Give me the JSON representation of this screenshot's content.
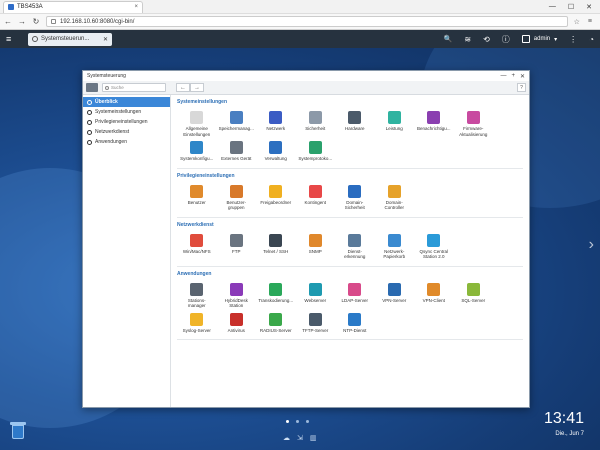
{
  "browser": {
    "tab_title": "TBS453A",
    "url": "192.168.10.60:8080/cgi-bin/",
    "close_glyph": "×",
    "win_min": "—",
    "win_max": "☐",
    "win_close": "✕",
    "back_glyph": "←",
    "forward_glyph": "→",
    "reload_glyph": "↻",
    "star_glyph": "☆",
    "menu_glyph": "≡"
  },
  "qts": {
    "app_tab": "Systemsteuerun...",
    "tab_close": "✕",
    "user": "admin",
    "menu_glyph": "≡",
    "search_glyph": "🔍",
    "tasks_glyph": "≋",
    "sync_glyph": "⟲",
    "info_glyph": "ⓘ",
    "more_glyph": "⋮",
    "dashboard_glyph": "◔"
  },
  "window": {
    "title": "Systemsteuerung",
    "ctrl_min": "—",
    "ctrl_max": "+",
    "ctrl_close": "✕",
    "search_placeholder": "Suche",
    "back_glyph": "←",
    "forward_glyph": "→",
    "help_glyph": "?"
  },
  "sidebar": {
    "items": [
      {
        "label": "Überblick",
        "active": true
      },
      {
        "label": "Systemeinstellungen"
      },
      {
        "label": "Privilegieneinstellungen"
      },
      {
        "label": "Netzwerkdienst"
      },
      {
        "label": "Anwendungen"
      }
    ]
  },
  "sections": [
    {
      "title": "Systemeinstellungen",
      "items": [
        {
          "l1": "Allgemeine",
          "l2": "Einstellungen",
          "icon": "general-settings-icon",
          "color": "#d8d8d8"
        },
        {
          "l1": "Speichermanag...",
          "l2": "",
          "icon": "storage-manager-icon",
          "color": "#4a7fc1"
        },
        {
          "l1": "Netzwerk",
          "l2": "",
          "icon": "network-icon",
          "color": "#3b5cc4"
        },
        {
          "l1": "Sicherheit",
          "l2": "",
          "icon": "security-lock-icon",
          "color": "#8c99a8"
        },
        {
          "l1": "Hardware",
          "l2": "",
          "icon": "hardware-icon",
          "color": "#4b5a6a"
        },
        {
          "l1": "Leistung",
          "l2": "",
          "icon": "power-bulb-icon",
          "color": "#2fb3a0"
        },
        {
          "l1": "Benachrichtigu...",
          "l2": "",
          "icon": "notification-icon",
          "color": "#8a3fb0"
        },
        {
          "l1": "Firmware-",
          "l2": "Aktualisierung",
          "icon": "firmware-update-icon",
          "color": "#c84aa0"
        },
        {
          "l1": "Systemkonfigu...",
          "l2": "",
          "icon": "system-config-icon",
          "color": "#2e86c8"
        },
        {
          "l1": "Externes Gerät",
          "l2": "",
          "icon": "external-device-icon",
          "color": "#6a7480"
        },
        {
          "l1": "Verwaltung",
          "l2": "",
          "icon": "management-monitor-icon",
          "color": "#2c6fc0"
        },
        {
          "l1": "Systemprotoko...",
          "l2": "",
          "icon": "system-logs-icon",
          "color": "#2aa16c"
        }
      ]
    },
    {
      "title": "Privilegieneinstellungen",
      "items": [
        {
          "l1": "Benutzer",
          "l2": "",
          "icon": "user-icon",
          "color": "#e08a2c"
        },
        {
          "l1": "Benutzer-",
          "l2": "gruppen",
          "icon": "user-groups-icon",
          "color": "#d8792a"
        },
        {
          "l1": "Freigabeordner",
          "l2": "",
          "icon": "shared-folder-icon",
          "color": "#f0b020"
        },
        {
          "l1": "Kontingent",
          "l2": "",
          "icon": "quota-pie-icon",
          "color": "#e84848"
        },
        {
          "l1": "Domain-",
          "l2": "Sicherheit",
          "icon": "domain-security-icon",
          "color": "#2a6cc0"
        },
        {
          "l1": "Domain-",
          "l2": "Controller",
          "icon": "domain-controller-icon",
          "color": "#e6a22a"
        }
      ]
    },
    {
      "title": "Netzwerkdienst",
      "items": [
        {
          "l1": "Win/Mac/NFS",
          "l2": "",
          "icon": "win-mac-nfs-icon",
          "color": "#e04c3c"
        },
        {
          "l1": "FTP",
          "l2": "",
          "icon": "ftp-icon",
          "color": "#6a7480"
        },
        {
          "l1": "Telnet / SSH",
          "l2": "",
          "icon": "telnet-ssh-icon",
          "color": "#3a4652"
        },
        {
          "l1": "SNMP",
          "l2": "",
          "icon": "snmp-icon",
          "color": "#e0882c"
        },
        {
          "l1": "Dienst-",
          "l2": "erkennung",
          "icon": "service-discovery-icon",
          "color": "#5a7a9a"
        },
        {
          "l1": "Netzwerk-",
          "l2": "Papierkorb",
          "icon": "network-recycle-icon",
          "color": "#3a8ad0"
        },
        {
          "l1": "Qsync Central",
          "l2": "Station 2.0",
          "icon": "qsync-icon",
          "color": "#2a9ad8"
        }
      ]
    },
    {
      "title": "Anwendungen",
      "items": [
        {
          "l1": "Stations-",
          "l2": "manager",
          "icon": "station-manager-icon",
          "color": "#5a6470"
        },
        {
          "l1": "HybridDesk",
          "l2": "Station",
          "icon": "hybriddesk-icon",
          "color": "#8a3ab8"
        },
        {
          "l1": "Transkodierung...",
          "l2": "",
          "icon": "transcoding-icon",
          "color": "#2aa85a"
        },
        {
          "l1": "Webserver",
          "l2": "",
          "icon": "webserver-globe-icon",
          "color": "#1e9ab0"
        },
        {
          "l1": "LDAP-Server",
          "l2": "",
          "icon": "ldap-server-icon",
          "color": "#d84a8a"
        },
        {
          "l1": "VPN-Server",
          "l2": "",
          "icon": "vpn-server-icon",
          "color": "#2a6ab0"
        },
        {
          "l1": "VPN-Client",
          "l2": "",
          "icon": "vpn-client-icon",
          "color": "#e08a2a"
        },
        {
          "l1": "SQL-Server",
          "l2": "",
          "icon": "sql-server-icon",
          "color": "#8ab83a"
        },
        {
          "l1": "Syslog-Server",
          "l2": "",
          "icon": "syslog-server-icon",
          "color": "#f0b428"
        },
        {
          "l1": "Antivirus",
          "l2": "",
          "icon": "antivirus-icon",
          "color": "#c8302a"
        },
        {
          "l1": "RADIUS-Server",
          "l2": "",
          "icon": "radius-server-icon",
          "color": "#3aa84a"
        },
        {
          "l1": "TFTP-Server",
          "l2": "",
          "icon": "tftp-server-icon",
          "color": "#4a5a6a"
        },
        {
          "l1": "NTP-Dienst",
          "l2": "",
          "icon": "ntp-service-icon",
          "color": "#2a7ac8"
        }
      ]
    }
  ],
  "desktop": {
    "time": "13:41",
    "date": "Die., Jun 7",
    "right_arrow": "›",
    "page_dots": 3,
    "active_dot": 0,
    "cloud_glyph": "☁",
    "minimize_glyph": "⇲",
    "book_glyph": "▥"
  }
}
